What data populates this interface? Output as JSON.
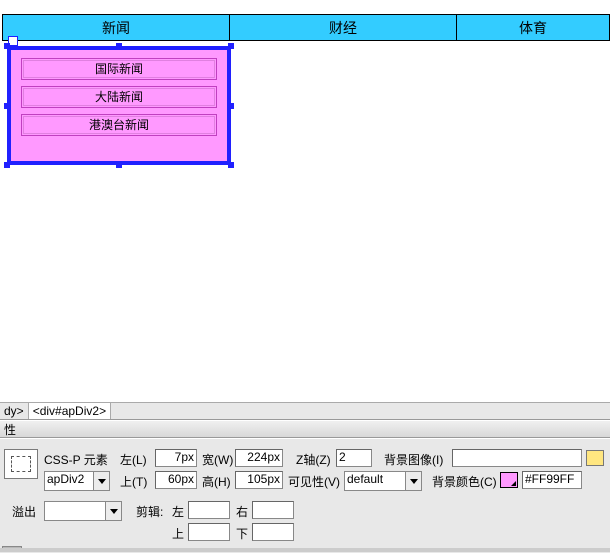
{
  "nav_tabs": [
    "新闻",
    "财经",
    "体育"
  ],
  "submenu": {
    "items": [
      "国际新闻",
      "大陆新闻",
      "港澳台新闻"
    ]
  },
  "tag_selector": {
    "body": "dy>",
    "selected": "<div#apDiv2>"
  },
  "props_header": "性",
  "panel": {
    "csspLabel": "CSS-P 元素",
    "idValue": "apDiv2",
    "left": {
      "label": "左(L)",
      "value": "7px"
    },
    "width": {
      "label": "宽(W)",
      "value": "224px"
    },
    "z": {
      "label": "Z轴(Z)",
      "value": "2"
    },
    "bgimg": {
      "label": "背景图像(I)",
      "value": ""
    },
    "top": {
      "label": "上(T)",
      "value": "60px"
    },
    "height": {
      "label": "高(H)",
      "value": "105px"
    },
    "visibility": {
      "label": "可见性(V)",
      "value": "default"
    },
    "bgcolor": {
      "label": "背景颜色(C)",
      "value": "#FF99FF"
    },
    "overflow": {
      "label": "溢出",
      "value": ""
    },
    "clip": {
      "label": "剪辑:",
      "leftLabel": "左",
      "leftValue": "",
      "rightLabel": "右",
      "rightValue": "",
      "topLabel": "上",
      "topValue": "",
      "bottomLabel": "下",
      "bottomValue": ""
    }
  },
  "colors": {
    "navBg": "#33CCFF",
    "apDivBg": "#FF99FF",
    "selection": "#2020FF"
  }
}
